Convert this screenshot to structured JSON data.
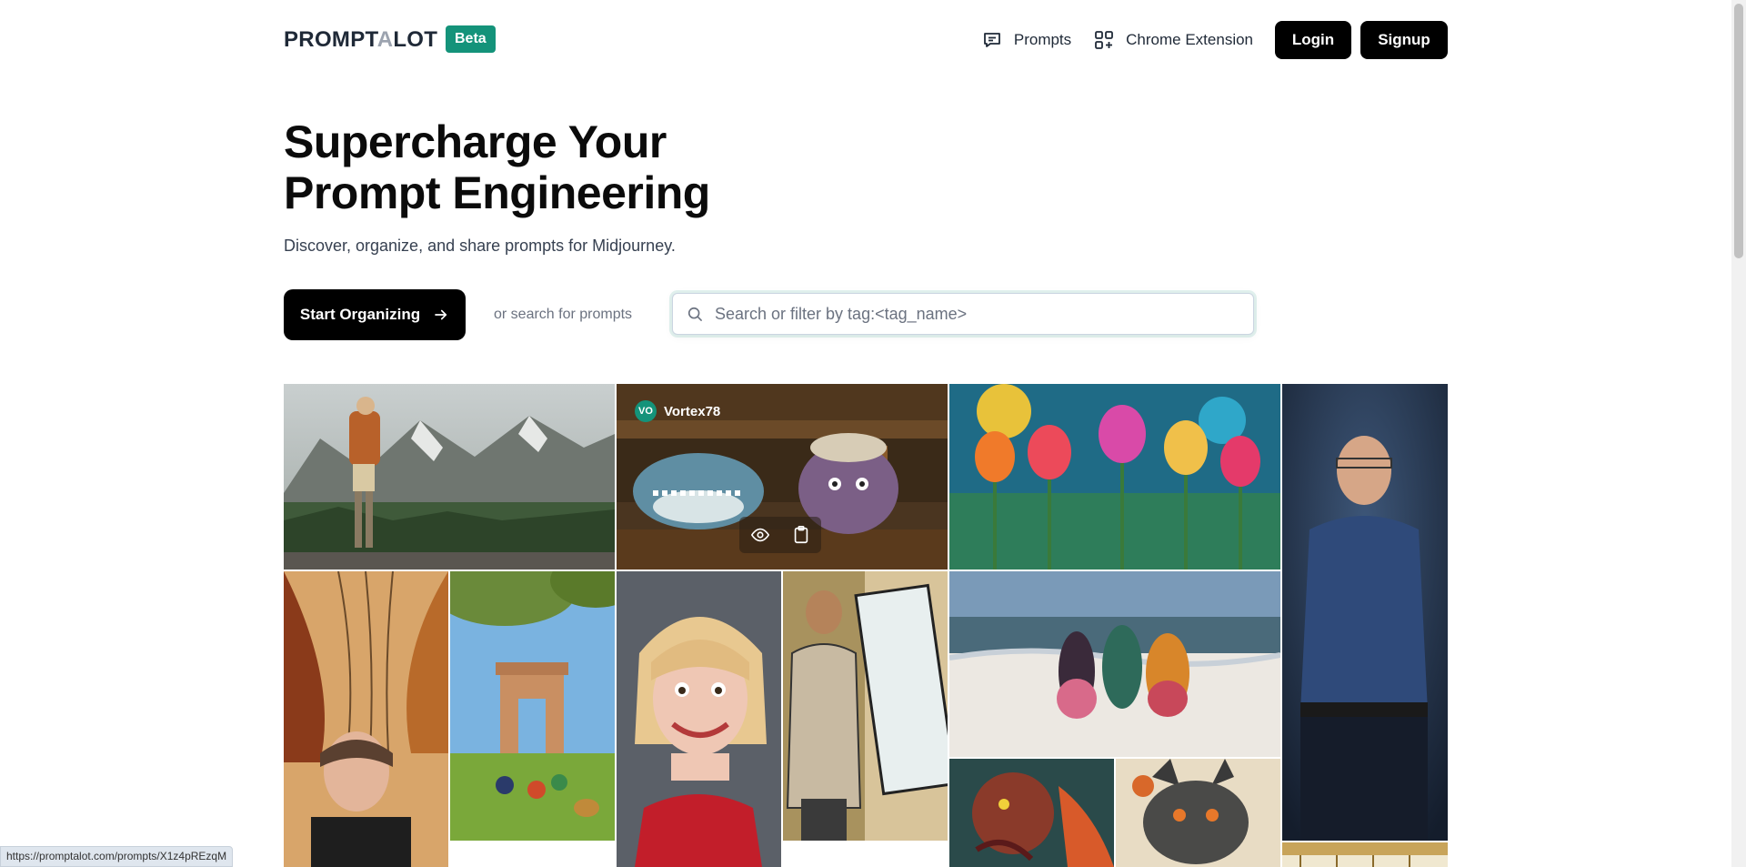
{
  "header": {
    "logo_part1": "PROMPT",
    "logo_accent": "A",
    "logo_part2": "LOT",
    "badge": "Beta",
    "nav": {
      "prompts": "Prompts",
      "chrome_extension": "Chrome Extension",
      "login": "Login",
      "signup": "Signup"
    }
  },
  "hero": {
    "title_line1": "Supercharge Your",
    "title_line2": "Prompt Engineering",
    "subtitle": "Discover, organize, and share prompts for Midjourney.",
    "cta": "Start Organizing",
    "or_search": "or search for prompts",
    "search_placeholder": "Search or filter by tag:<tag_name>"
  },
  "gallery": {
    "hovered_user": {
      "initials": "VO",
      "name": "Vortex78"
    },
    "tiles": [
      {
        "subject": "hiker-in-valley-image"
      },
      {
        "subject": "shark-and-octopus-bar-image"
      },
      {
        "subject": "stained-glass-tulips-image"
      },
      {
        "subject": "smiling-man-portrait-image"
      },
      {
        "subject": "woman-flowing-hair-image"
      },
      {
        "subject": "india-gate-picnic-image"
      },
      {
        "subject": "cartoon-blonde-woman-image"
      },
      {
        "subject": "comic-man-image"
      },
      {
        "subject": "snow-beach-painting-image"
      },
      {
        "subject": "sea-monster-image"
      },
      {
        "subject": "dragon-image"
      },
      {
        "subject": "building-image"
      }
    ]
  },
  "status_url": "https://promptalot.com/prompts/X1z4pREzqM",
  "colors": {
    "brand": "#14937a",
    "dark": "#000000"
  }
}
